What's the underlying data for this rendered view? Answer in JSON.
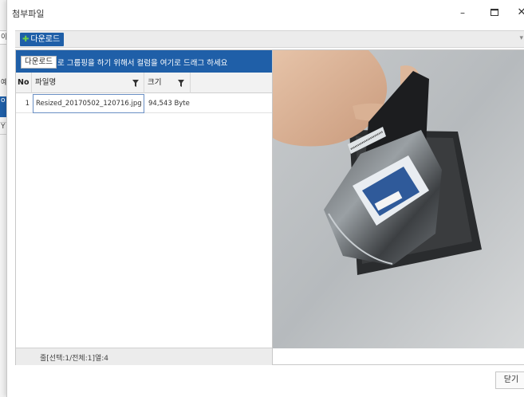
{
  "window": {
    "title": "첨부파일",
    "minimize_glyph": "–",
    "maximize_glyph": "☐",
    "close_glyph": "✕"
  },
  "background_app": {
    "cells": [
      "이",
      "예",
      "o",
      "Y"
    ]
  },
  "toolbar": {
    "download_label": "다운로드",
    "download_icon": "plus-icon",
    "overflow_glyph": "▾"
  },
  "grid": {
    "group_bar_text": "로 그룹핑을 하기 위해서 컬럼을 여기로 드래그 하세요",
    "drag_tooltip": "다운로드",
    "columns": [
      {
        "label": "No"
      },
      {
        "label": "파일명",
        "filter": true
      },
      {
        "label": "크기",
        "filter": true
      }
    ],
    "rows": [
      {
        "no": "1",
        "name": "Resized_20170502_120716.jpg",
        "size": "94,543 Byte"
      }
    ],
    "footer": "줄[선택:1/전체:1]열:4"
  },
  "preview": {
    "image": "photo of hand holding hard drive in anti-static bag"
  },
  "buttons": {
    "close_label": "닫기"
  },
  "colors": {
    "accent": "#1f5fa8",
    "plus_green": "#6fcf4a"
  }
}
